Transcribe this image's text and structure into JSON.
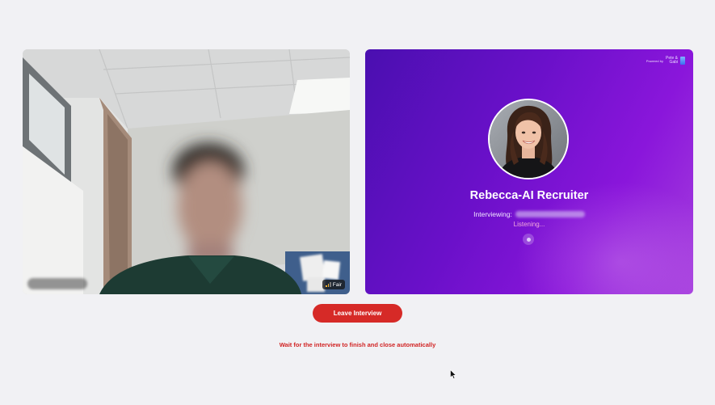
{
  "video": {
    "participant_name": "",
    "connection_quality": "Fair"
  },
  "ai_panel": {
    "powered_by": "Powered by",
    "brand_line1": "Pete &",
    "brand_line2": "Gabi",
    "recruiter_name": "Rebecca-AI Recruiter",
    "interviewing_label": "Interviewing:",
    "status": "Listening..."
  },
  "controls": {
    "leave_label": "Leave Interview",
    "hint": "Wait for the interview to finish and close automatically"
  },
  "colors": {
    "leave_button": "#d62a27",
    "hint_text": "#d12424",
    "panel_gradient_start": "#4a0fb0",
    "panel_gradient_end": "#a63fde"
  }
}
